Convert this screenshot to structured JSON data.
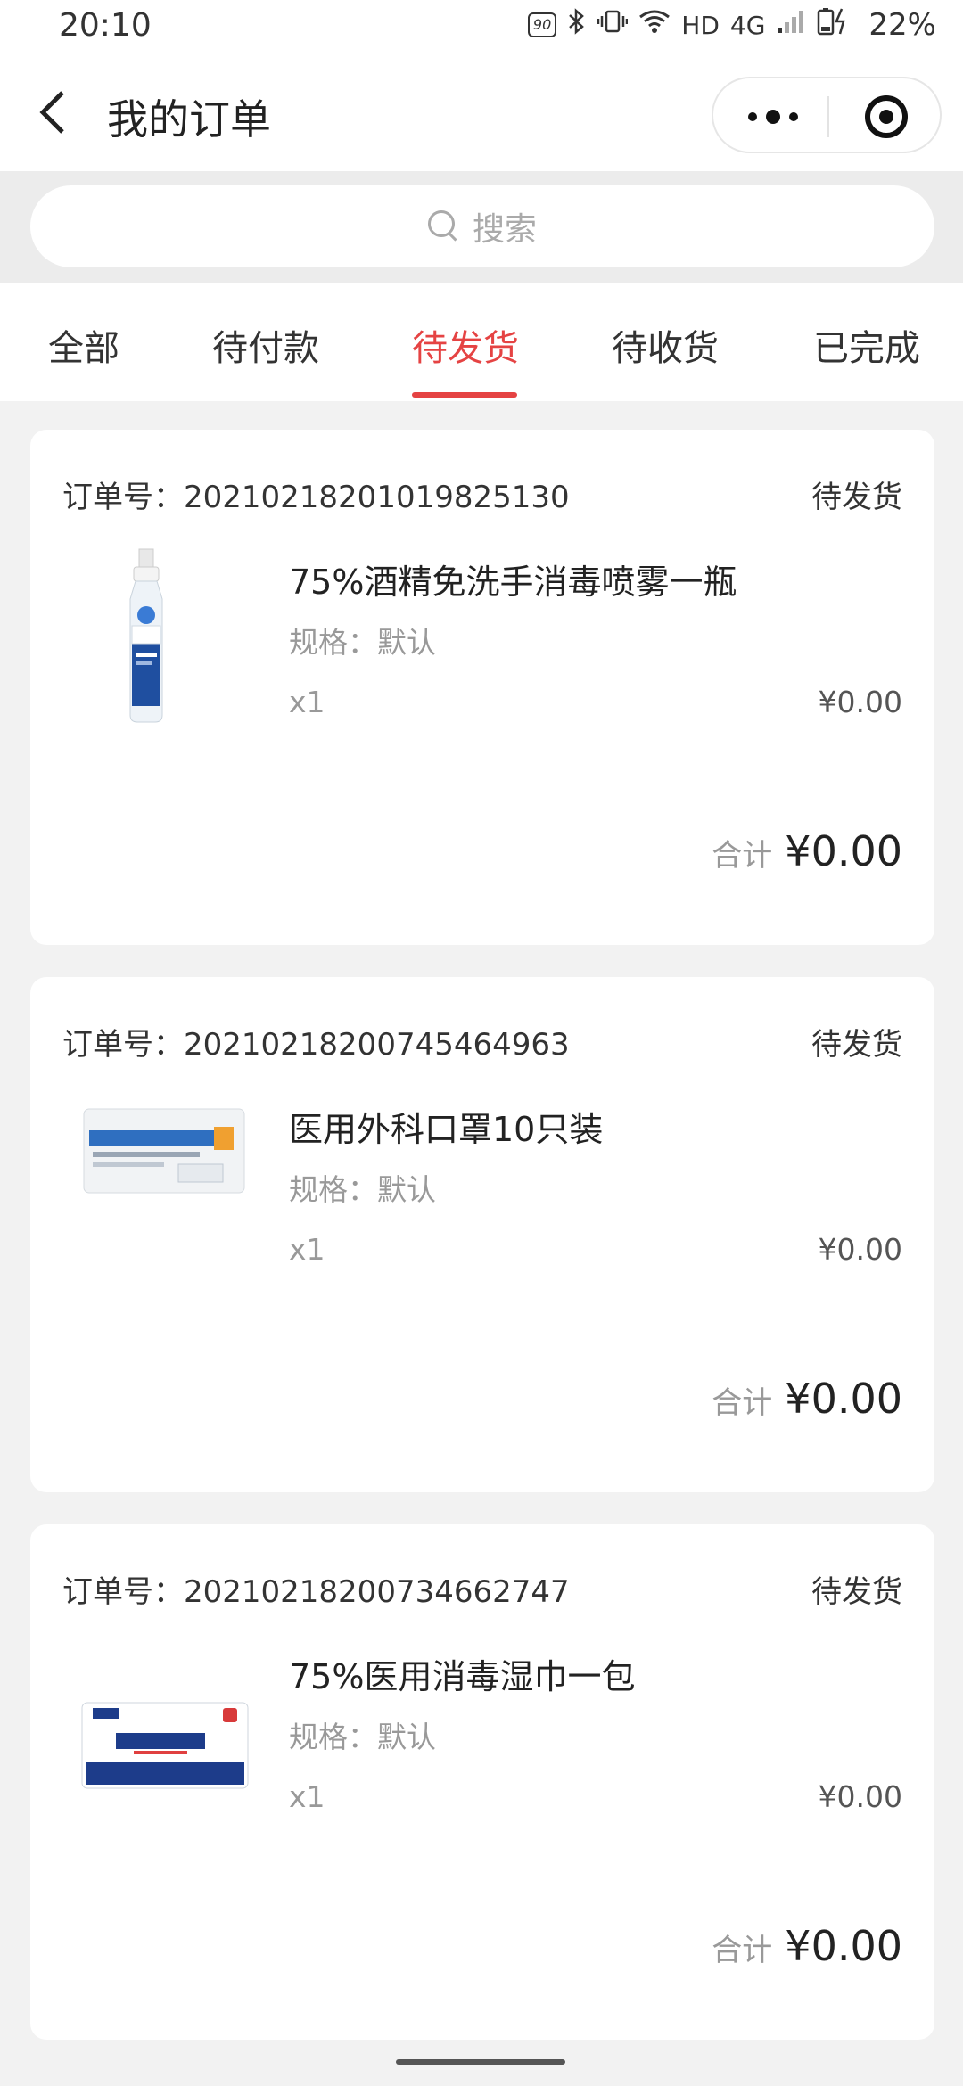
{
  "status_bar": {
    "time": "20:10",
    "refresh_rate": "90",
    "network_hd": "HD",
    "network_type": "4G",
    "battery": "22%"
  },
  "header": {
    "title": "我的订单"
  },
  "search": {
    "placeholder": "搜索"
  },
  "tabs": [
    {
      "label": "全部"
    },
    {
      "label": "待付款"
    },
    {
      "label": "待发货"
    },
    {
      "label": "待收货"
    },
    {
      "label": "已完成"
    }
  ],
  "active_tab_label": "待发货",
  "accent_color": "#e54343",
  "orders": [
    {
      "order_no": "订单号：20210218201019825130",
      "status": "待发货",
      "product_name": "75%酒精免洗手消毒喷雾一瓶",
      "spec": "规格：默认",
      "qty": "x1",
      "price": "¥0.00",
      "total_label": "合计",
      "total": "¥0.00",
      "image_icon": "spray-bottle-image"
    },
    {
      "order_no": "订单号：20210218200745464963",
      "status": "待发货",
      "product_name": "医用外科口罩10只装",
      "spec": "规格：默认",
      "qty": "x1",
      "price": "¥0.00",
      "total_label": "合计",
      "total": "¥0.00",
      "image_icon": "mask-pack-image"
    },
    {
      "order_no": "订单号：20210218200734662747",
      "status": "待发货",
      "product_name": "75%医用消毒湿巾一包",
      "spec": "规格：默认",
      "qty": "x1",
      "price": "¥0.00",
      "total_label": "合计",
      "total": "¥0.00",
      "image_icon": "wipes-pack-image"
    }
  ]
}
